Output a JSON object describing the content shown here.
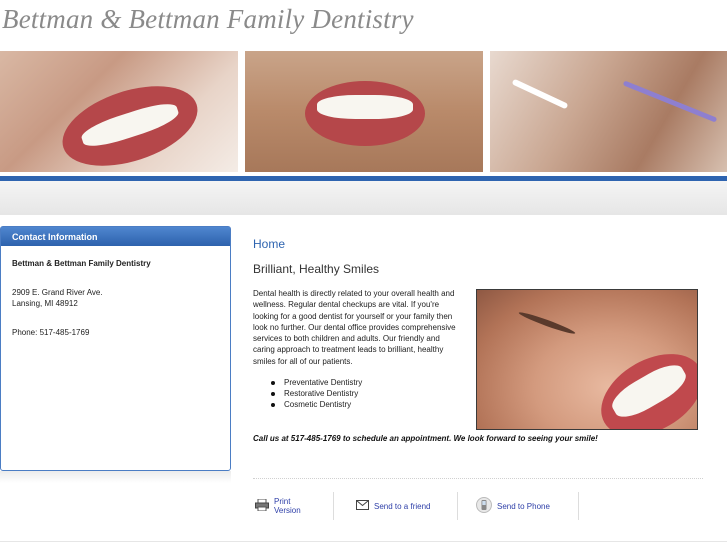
{
  "site": {
    "title": "Bettman & Bettman Family Dentistry"
  },
  "sidebar": {
    "heading": "Contact Information",
    "business_name": "Bettman & Bettman Family Dentistry",
    "address_line1": "2909 E. Grand River Ave.",
    "address_line2": "Lansing, MI 48912",
    "phone": "Phone: 517-485-1769"
  },
  "main": {
    "page_heading": "Home",
    "sub_heading": "Brilliant, Healthy Smiles",
    "intro": "Dental health is directly related to your overall health and wellness. Regular dental checkups are vital. If you're looking for a good dentist for yourself or your family then look no further. Our dental office provides comprehensive services to both children and adults. Our friendly and caring approach to treatment leads to brilliant, healthy smiles for all of our patients.",
    "services": [
      "Preventative Dentistry",
      "Restorative Dentistry",
      "Cosmetic Dentistry"
    ],
    "cta": "Call us at 517-485-1769 to schedule an appointment. We look forward to seeing your smile!"
  },
  "actions": {
    "print": "Print Version",
    "send_friend": "Send to a friend",
    "send_phone": "Send to Phone"
  },
  "colors": {
    "accent": "#2e64b0",
    "link": "#2e3fa8",
    "title": "#8a8a8a"
  },
  "icons": [
    "printer-icon",
    "envelope-icon",
    "phone-icon"
  ]
}
